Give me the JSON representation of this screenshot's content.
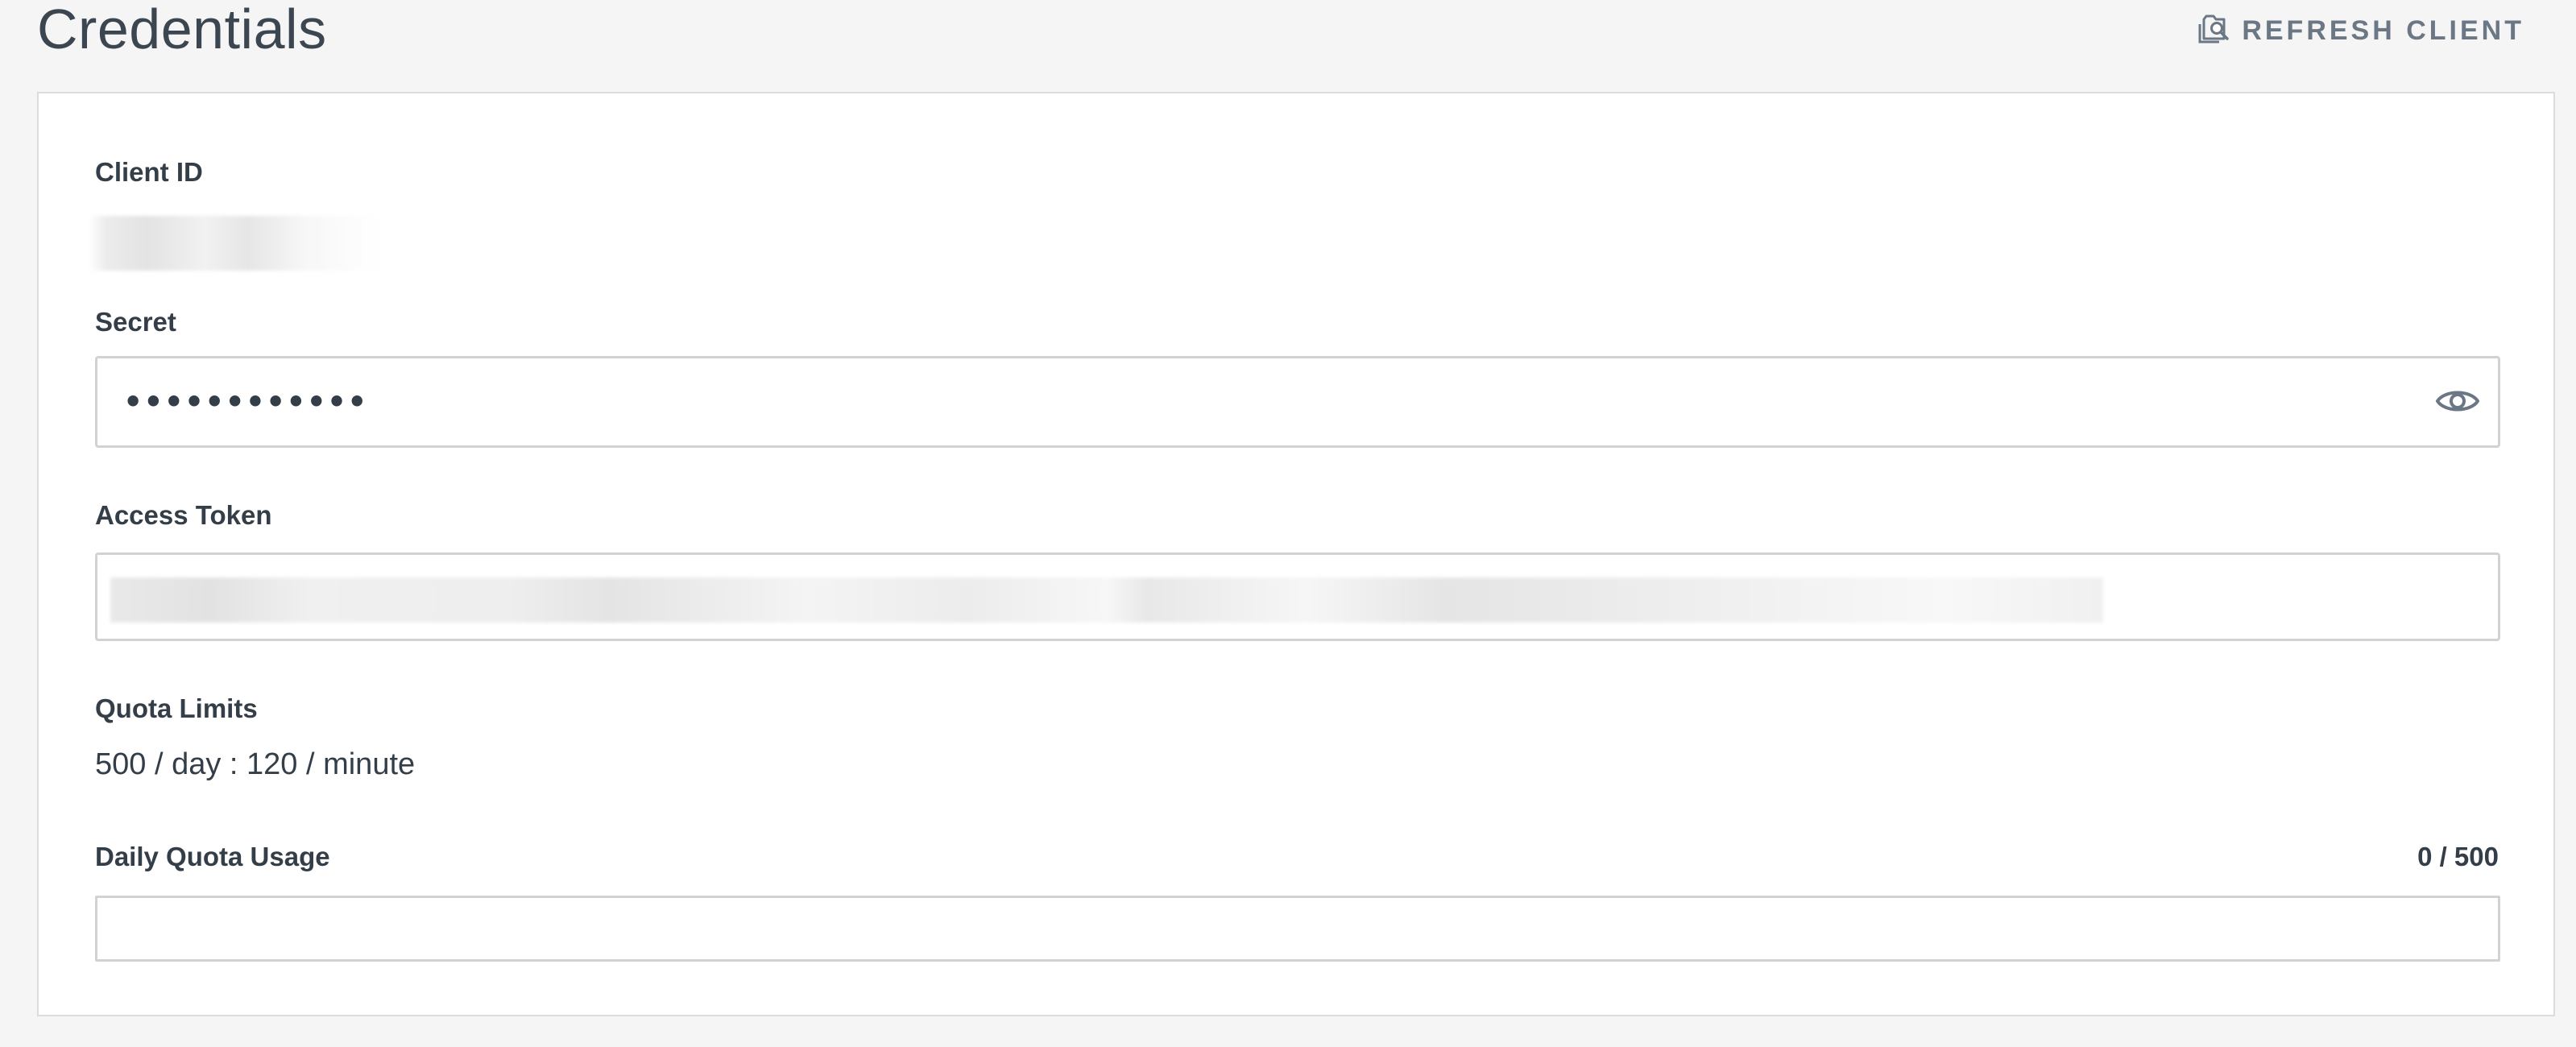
{
  "page": {
    "title": "Credentials",
    "refresh_label": "REFRESH CLIENT"
  },
  "client_id": {
    "label": "Client ID"
  },
  "secret": {
    "label": "Secret",
    "value": "••••••••••••"
  },
  "access_token": {
    "label": "Access Token"
  },
  "quota_limits": {
    "label": "Quota Limits",
    "value": "500 / day : 120 / minute"
  },
  "daily_usage": {
    "label": "Daily Quota Usage",
    "count": "0 / 500",
    "fraction": 0
  },
  "icons": {
    "refresh": "refresh-icon",
    "eye": "eye-icon"
  },
  "colors": {
    "text": "#333e48",
    "muted": "#6b7785",
    "border": "#d0d2d4",
    "background": "#f5f5f5",
    "progress": "#00bf6f"
  }
}
